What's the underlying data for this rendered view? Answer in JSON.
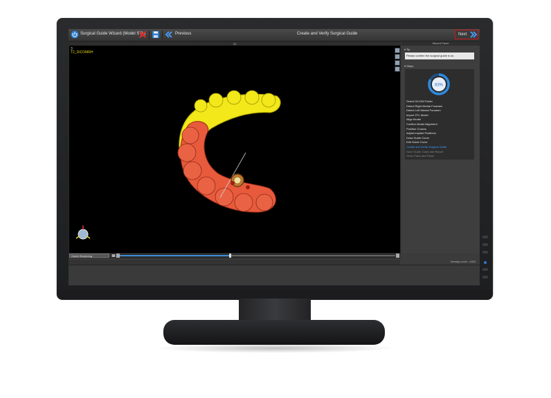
{
  "app": {
    "wizard_title": "Surgical Guide Wizard (Model STL)",
    "previous_label": "Previous",
    "center_title": "Create and Verify Surgical Guide",
    "next_label": "Next"
  },
  "viewport": {
    "header": "3D",
    "label_1": "3",
    "label_2": "T2_DICOMRH",
    "render_mode": "Guide Rendering",
    "slider_value": 0.4
  },
  "panel": {
    "title": "Wizard Panel",
    "tip_header": "Tip",
    "tip_text": "Please confirm the surgical guide is ok.",
    "steps_header": "Steps",
    "progress_text": "83%",
    "progress_value": 0.83,
    "steps": [
      {
        "label": "Select DICOM Folder",
        "state": "done"
      },
      {
        "label": "Detect Right Mental Foramen",
        "state": "done"
      },
      {
        "label": "Detect Left Mental Foramen",
        "state": "done"
      },
      {
        "label": "Import STL Model",
        "state": "done"
      },
      {
        "label": "Align Model",
        "state": "done"
      },
      {
        "label": "Confirm Model Alignment",
        "state": "done"
      },
      {
        "label": "Position Crowns",
        "state": "done"
      },
      {
        "label": "Adjust Implant Positions",
        "state": "done"
      },
      {
        "label": "Draw Guide Curve",
        "state": "done"
      },
      {
        "label": "Edit Guide Curve",
        "state": "done"
      },
      {
        "label": "Create and Verify Surgical Guide",
        "state": "current"
      },
      {
        "label": "Save Guide, Case and Report",
        "state": "pending"
      },
      {
        "label": "Order Parts and Finish",
        "state": "pending"
      }
    ]
  },
  "status": {
    "density_text": "Density Level : 1000"
  },
  "colors": {
    "current_step": "#3aa0ff",
    "done_step": "#e6e6e6",
    "pending_step": "#8a8a8a",
    "guide": "#e85a3c",
    "arch": "#f2e81a",
    "accent": "#2d8be0"
  },
  "icons": {
    "wizard": "power-icon",
    "cancel": "close-x-icon",
    "save": "save-icon",
    "previous": "double-chevron-left-icon",
    "next": "double-chevron-right-icon"
  }
}
